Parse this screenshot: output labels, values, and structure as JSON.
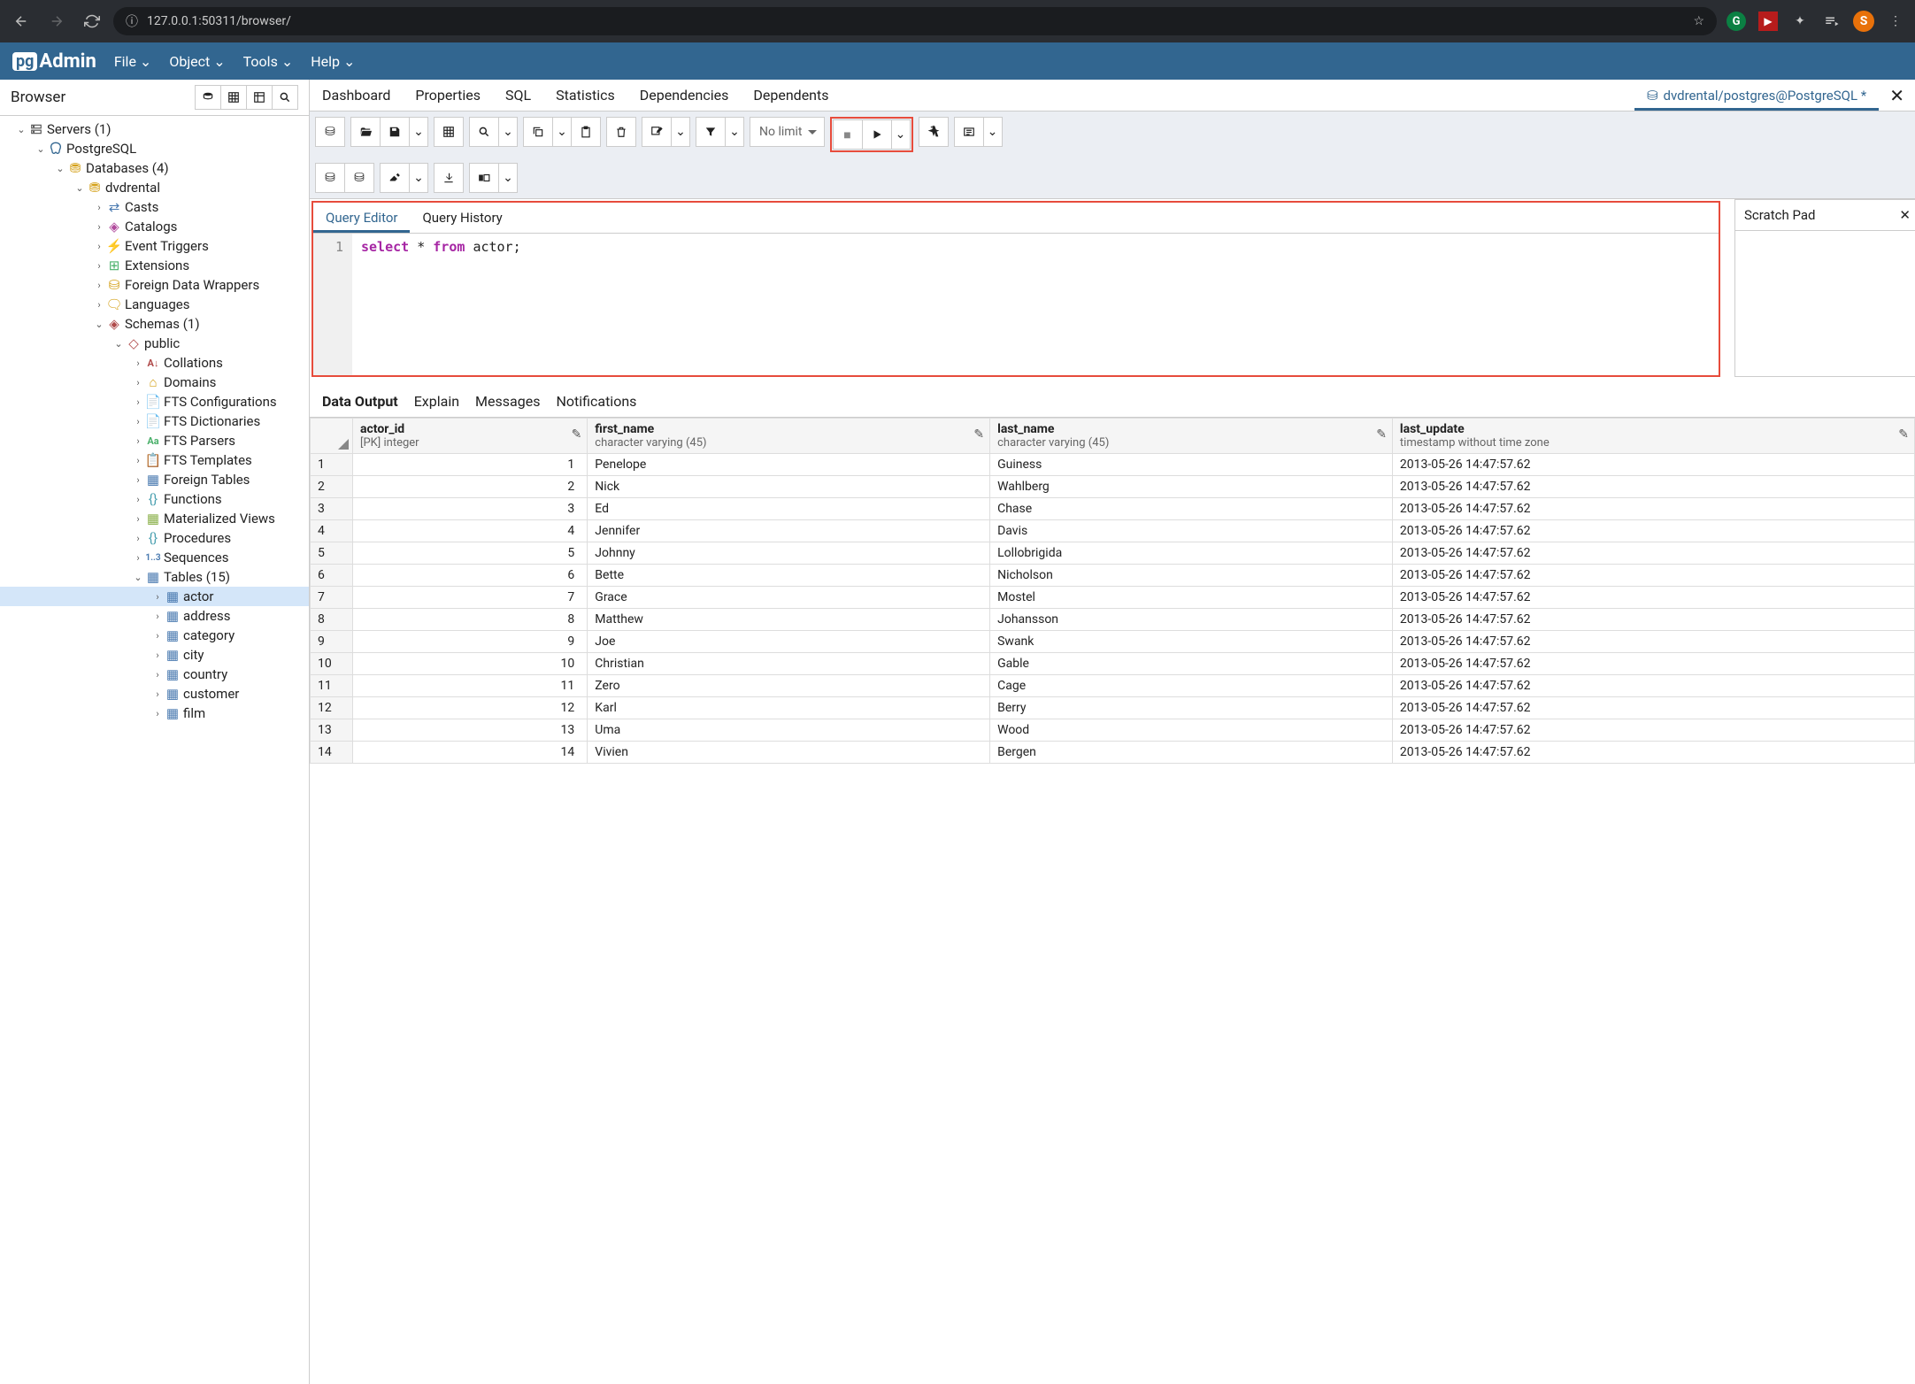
{
  "browser": {
    "url": "127.0.0.1:50311/browser/"
  },
  "pg": {
    "logo_pg": "pg",
    "logo_admin": "Admin"
  },
  "menu": {
    "file": "File",
    "object": "Object",
    "tools": "Tools",
    "help": "Help"
  },
  "sidebar": {
    "title": "Browser",
    "tree": [
      {
        "d": 0,
        "a": "v",
        "ic": "srv",
        "t": "Servers (1)"
      },
      {
        "d": 1,
        "a": "v",
        "ic": "pg",
        "t": "PostgreSQL"
      },
      {
        "d": 2,
        "a": "v",
        "ic": "dbs",
        "t": "Databases (4)"
      },
      {
        "d": 3,
        "a": "v",
        "ic": "db",
        "t": "dvdrental"
      },
      {
        "d": 4,
        "a": ">",
        "ic": "cast",
        "t": "Casts"
      },
      {
        "d": 4,
        "a": ">",
        "ic": "cat",
        "t": "Catalogs"
      },
      {
        "d": 4,
        "a": ">",
        "ic": "evt",
        "t": "Event Triggers"
      },
      {
        "d": 4,
        "a": ">",
        "ic": "ext",
        "t": "Extensions"
      },
      {
        "d": 4,
        "a": ">",
        "ic": "fdw",
        "t": "Foreign Data Wrappers"
      },
      {
        "d": 4,
        "a": ">",
        "ic": "lang",
        "t": "Languages"
      },
      {
        "d": 4,
        "a": "v",
        "ic": "sch",
        "t": "Schemas (1)"
      },
      {
        "d": 5,
        "a": "v",
        "ic": "pub",
        "t": "public"
      },
      {
        "d": 6,
        "a": ">",
        "ic": "coll",
        "t": "Collations"
      },
      {
        "d": 6,
        "a": ">",
        "ic": "dom",
        "t": "Domains"
      },
      {
        "d": 6,
        "a": ">",
        "ic": "fts",
        "t": "FTS Configurations"
      },
      {
        "d": 6,
        "a": ">",
        "ic": "fts",
        "t": "FTS Dictionaries"
      },
      {
        "d": 6,
        "a": ">",
        "ic": "ftp",
        "t": "FTS Parsers"
      },
      {
        "d": 6,
        "a": ">",
        "ic": "ftt",
        "t": "FTS Templates"
      },
      {
        "d": 6,
        "a": ">",
        "ic": "ft",
        "t": "Foreign Tables"
      },
      {
        "d": 6,
        "a": ">",
        "ic": "fn",
        "t": "Functions"
      },
      {
        "d": 6,
        "a": ">",
        "ic": "mv",
        "t": "Materialized Views"
      },
      {
        "d": 6,
        "a": ">",
        "ic": "proc",
        "t": "Procedures"
      },
      {
        "d": 6,
        "a": ">",
        "ic": "seq",
        "t": "Sequences"
      },
      {
        "d": 6,
        "a": "v",
        "ic": "tbls",
        "t": "Tables (15)"
      },
      {
        "d": 7,
        "a": ">",
        "ic": "tbl",
        "t": "actor",
        "sel": true
      },
      {
        "d": 7,
        "a": ">",
        "ic": "tbl",
        "t": "address"
      },
      {
        "d": 7,
        "a": ">",
        "ic": "tbl",
        "t": "category"
      },
      {
        "d": 7,
        "a": ">",
        "ic": "tbl",
        "t": "city"
      },
      {
        "d": 7,
        "a": ">",
        "ic": "tbl",
        "t": "country"
      },
      {
        "d": 7,
        "a": ">",
        "ic": "tbl",
        "t": "customer"
      },
      {
        "d": 7,
        "a": ">",
        "ic": "tbl",
        "t": "film"
      }
    ]
  },
  "maintabs": {
    "dashboard": "Dashboard",
    "properties": "Properties",
    "sql": "SQL",
    "statistics": "Statistics",
    "dependencies": "Dependencies",
    "dependents": "Dependents",
    "query": "dvdrental/postgres@PostgreSQL *"
  },
  "toolbar": {
    "nolimit": "No limit"
  },
  "query": {
    "tabs": {
      "editor": "Query Editor",
      "history": "Query History"
    },
    "line": "1",
    "kw_select": "select",
    "star": "*",
    "kw_from": "from",
    "tbl": "actor",
    "semi": ";"
  },
  "scratch": {
    "title": "Scratch Pad"
  },
  "results": {
    "tabs": {
      "data": "Data Output",
      "explain": "Explain",
      "messages": "Messages",
      "notifications": "Notifications"
    },
    "cols": [
      {
        "name": "actor_id",
        "type": "[PK] integer"
      },
      {
        "name": "first_name",
        "type": "character varying (45)"
      },
      {
        "name": "last_name",
        "type": "character varying (45)"
      },
      {
        "name": "last_update",
        "type": "timestamp without time zone"
      }
    ],
    "rows": [
      {
        "n": 1,
        "id": 1,
        "fn": "Penelope",
        "ln": "Guiness",
        "ts": "2013-05-26 14:47:57.62"
      },
      {
        "n": 2,
        "id": 2,
        "fn": "Nick",
        "ln": "Wahlberg",
        "ts": "2013-05-26 14:47:57.62"
      },
      {
        "n": 3,
        "id": 3,
        "fn": "Ed",
        "ln": "Chase",
        "ts": "2013-05-26 14:47:57.62"
      },
      {
        "n": 4,
        "id": 4,
        "fn": "Jennifer",
        "ln": "Davis",
        "ts": "2013-05-26 14:47:57.62"
      },
      {
        "n": 5,
        "id": 5,
        "fn": "Johnny",
        "ln": "Lollobrigida",
        "ts": "2013-05-26 14:47:57.62"
      },
      {
        "n": 6,
        "id": 6,
        "fn": "Bette",
        "ln": "Nicholson",
        "ts": "2013-05-26 14:47:57.62"
      },
      {
        "n": 7,
        "id": 7,
        "fn": "Grace",
        "ln": "Mostel",
        "ts": "2013-05-26 14:47:57.62"
      },
      {
        "n": 8,
        "id": 8,
        "fn": "Matthew",
        "ln": "Johansson",
        "ts": "2013-05-26 14:47:57.62"
      },
      {
        "n": 9,
        "id": 9,
        "fn": "Joe",
        "ln": "Swank",
        "ts": "2013-05-26 14:47:57.62"
      },
      {
        "n": 10,
        "id": 10,
        "fn": "Christian",
        "ln": "Gable",
        "ts": "2013-05-26 14:47:57.62"
      },
      {
        "n": 11,
        "id": 11,
        "fn": "Zero",
        "ln": "Cage",
        "ts": "2013-05-26 14:47:57.62"
      },
      {
        "n": 12,
        "id": 12,
        "fn": "Karl",
        "ln": "Berry",
        "ts": "2013-05-26 14:47:57.62"
      },
      {
        "n": 13,
        "id": 13,
        "fn": "Uma",
        "ln": "Wood",
        "ts": "2013-05-26 14:47:57.62"
      },
      {
        "n": 14,
        "id": 14,
        "fn": "Vivien",
        "ln": "Bergen",
        "ts": "2013-05-26 14:47:57.62"
      }
    ]
  }
}
